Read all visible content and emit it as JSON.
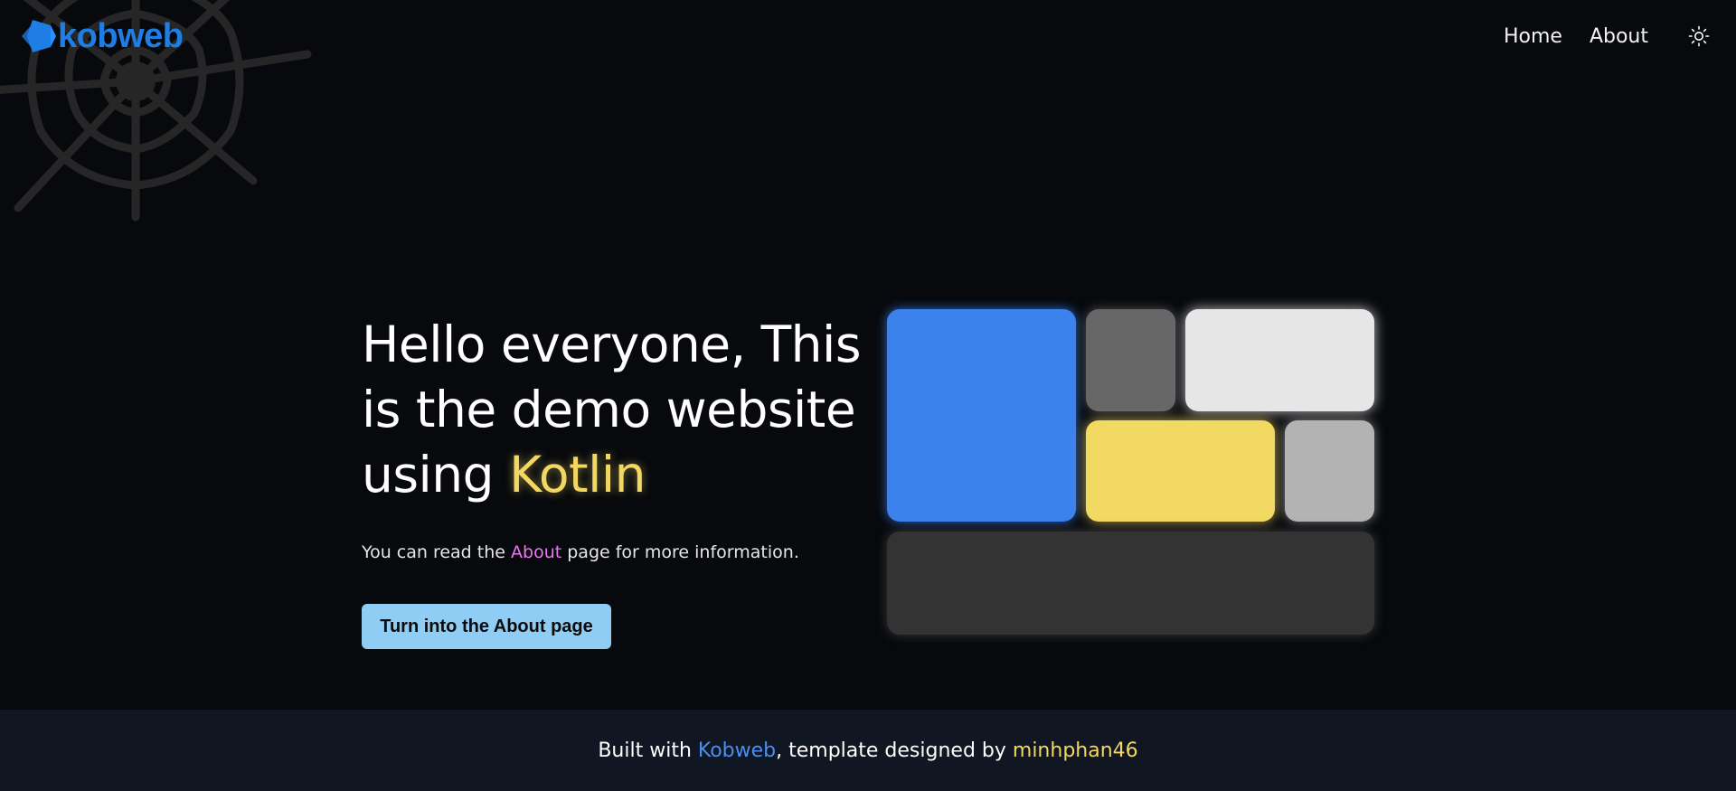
{
  "header": {
    "logo_text": "kobweb",
    "nav": [
      {
        "label": "Home"
      },
      {
        "label": "About"
      }
    ],
    "theme_toggle_icon": "sun-icon"
  },
  "hero": {
    "headline_part1": "Hello everyone, This is the demo website using ",
    "headline_highlight": "Kotlin",
    "subtext_before": "You can read the ",
    "subtext_link": "About",
    "subtext_after": " page for more information.",
    "cta_label": "Turn into the About page"
  },
  "footer": {
    "prefix": "Built with ",
    "kobweb_link": "Kobweb",
    "middle": ", template designed by ",
    "author_link": "minhphan46"
  },
  "colors": {
    "background": "#07090d",
    "footer_background": "#111722",
    "accent_blue": "#3b82ed",
    "accent_yellow": "#f2d862",
    "link_pink": "#e878f0",
    "button": "#90cdf4",
    "logo_blue": "#1f7ee6"
  },
  "tiles": [
    {
      "name": "blue-tile",
      "color": "#3b82ed"
    },
    {
      "name": "dark-gray-tile",
      "color": "#666666"
    },
    {
      "name": "white-tile",
      "color": "#e6e6e6"
    },
    {
      "name": "yellow-tile",
      "color": "#f2d962"
    },
    {
      "name": "light-gray-tile",
      "color": "#b3b3b3"
    },
    {
      "name": "charcoal-tile",
      "color": "#333333"
    }
  ]
}
